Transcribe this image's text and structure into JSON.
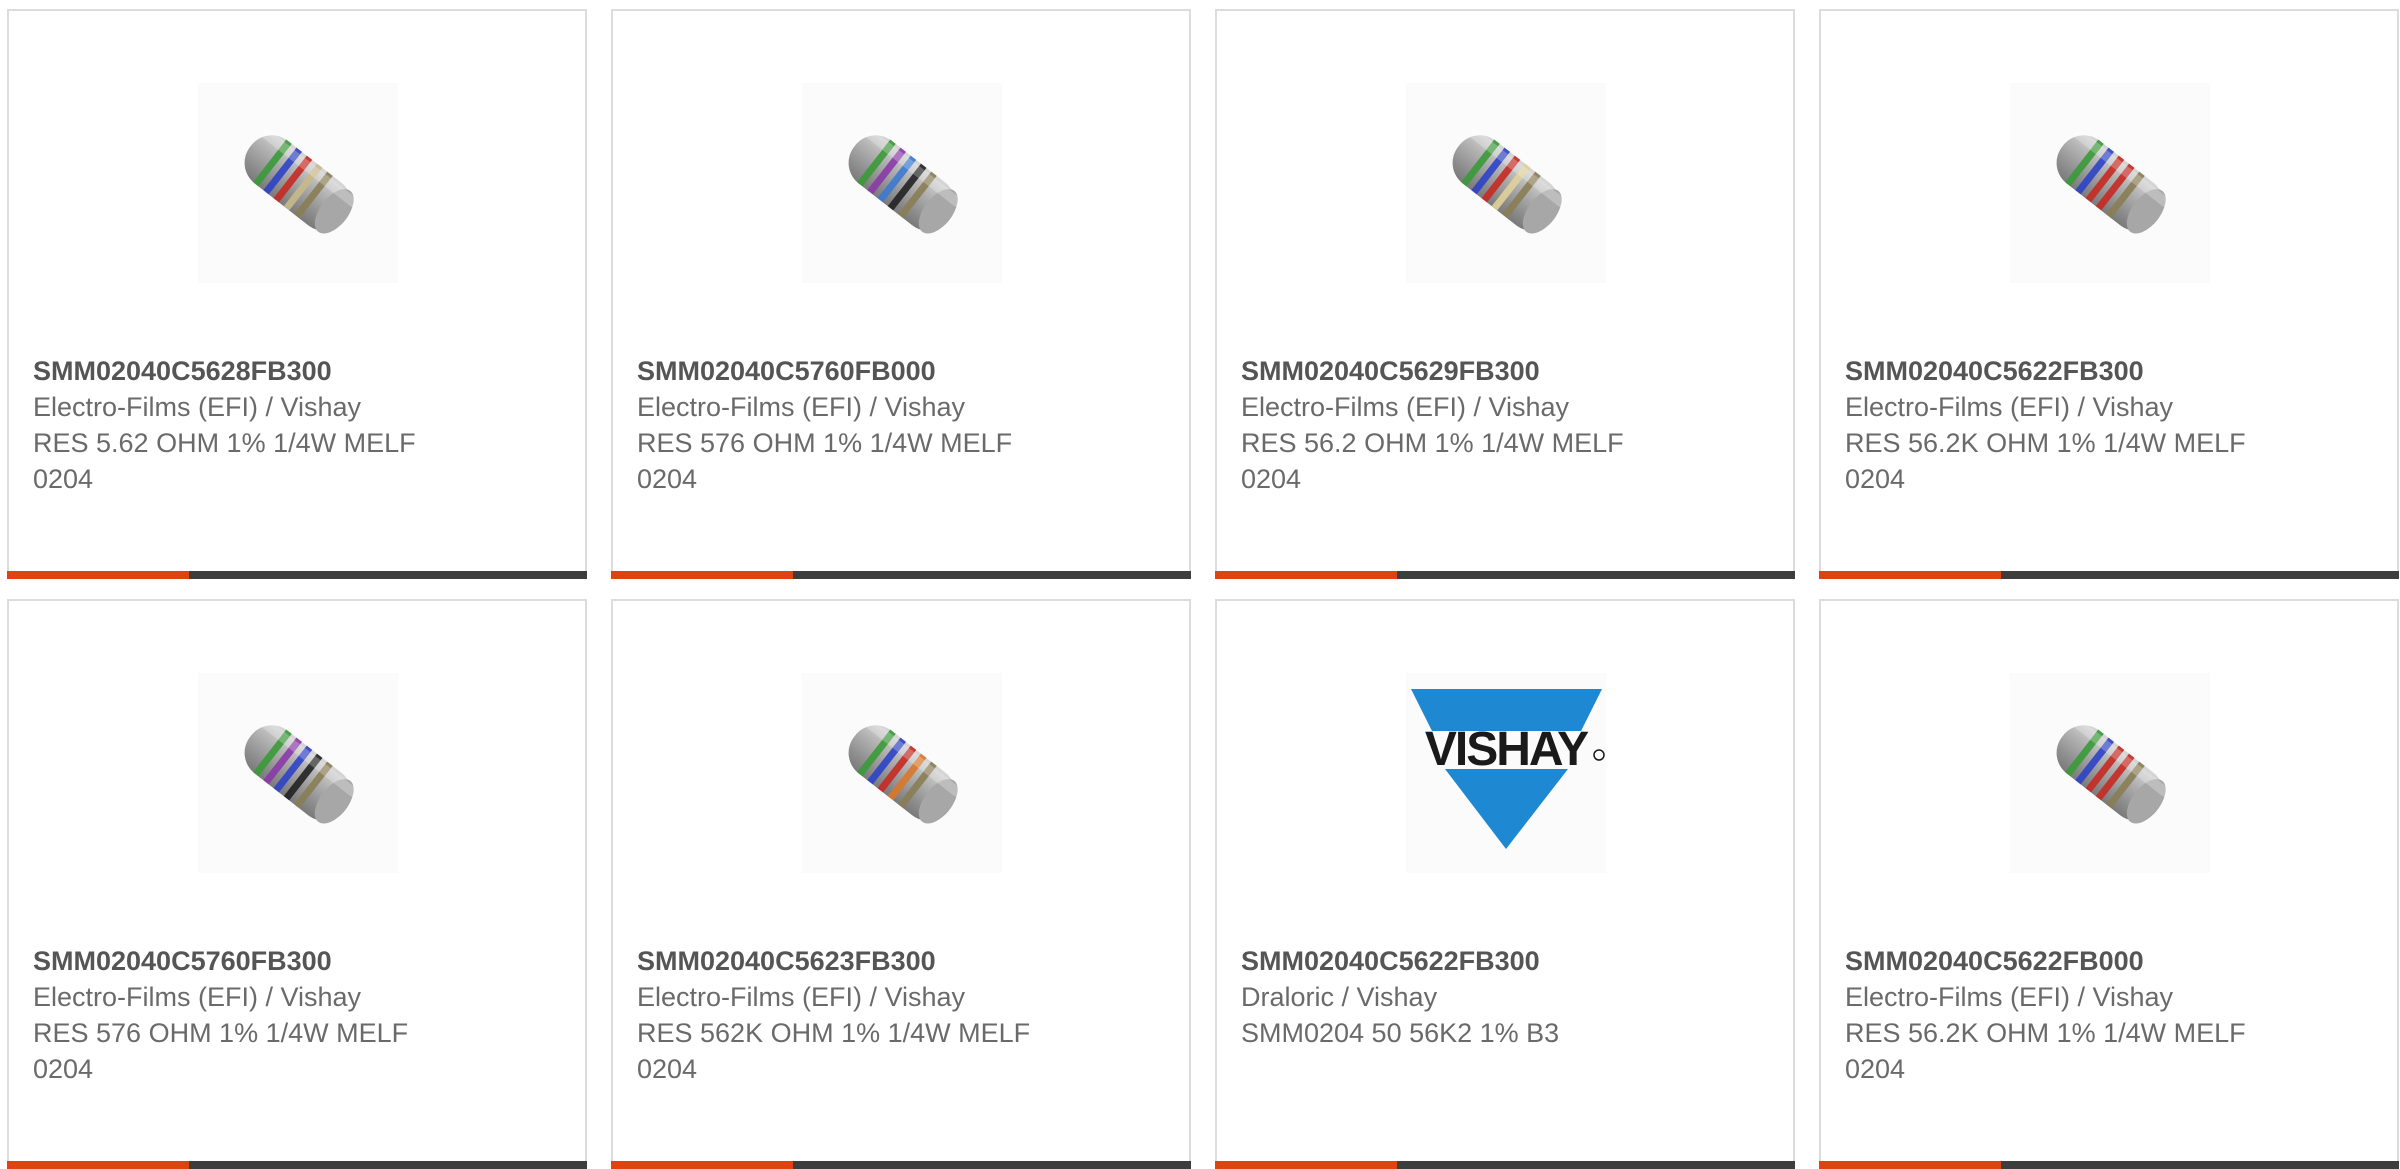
{
  "colors": {
    "accent": "#e04312",
    "bar": "#3d3d3d",
    "border": "#dcdcdc",
    "text": "#5e5e5e",
    "vishay_blue": "#1e88d2"
  },
  "products": [
    {
      "part_number": "SMM02040C5628FB300",
      "manufacturer": "Electro-Films (EFI) / Vishay",
      "description": "RES 5.62 OHM 1% 1/4W MELF 0204",
      "image": "resistor-image",
      "bands": [
        "#3a9a3a",
        "#2f43c6",
        "#c72a22",
        "#c9b98a",
        "#8a7d55"
      ]
    },
    {
      "part_number": "SMM02040C5760FB000",
      "manufacturer": "Electro-Films (EFI) / Vishay",
      "description": "RES 576 OHM 1% 1/4W MELF 0204",
      "image": "resistor-image",
      "bands": [
        "#3a9a3a",
        "#8a3aa8",
        "#3c7ad0",
        "#222222",
        "#8a7d55"
      ]
    },
    {
      "part_number": "SMM02040C5629FB300",
      "manufacturer": "Electro-Films (EFI) / Vishay",
      "description": "RES 56.2 OHM 1% 1/4W MELF 0204",
      "image": "resistor-image",
      "bands": [
        "#3a9a3a",
        "#2f43c6",
        "#c72a22",
        "#e0d29a",
        "#8a7d55"
      ]
    },
    {
      "part_number": "SMM02040C5622FB300",
      "manufacturer": "Electro-Films (EFI) / Vishay",
      "description": "RES 56.2K OHM 1% 1/4W MELF 0204",
      "image": "resistor-image",
      "bands": [
        "#3a9a3a",
        "#2f43c6",
        "#c72a22",
        "#c72a22",
        "#8a7d55"
      ]
    },
    {
      "part_number": "SMM02040C5760FB300",
      "manufacturer": "Electro-Films (EFI) / Vishay",
      "description": "RES 576 OHM 1% 1/4W MELF 0204",
      "image": "resistor-image",
      "bands": [
        "#3a9a3a",
        "#8a3aa8",
        "#2f43c6",
        "#222222",
        "#8a7d55"
      ]
    },
    {
      "part_number": "SMM02040C5623FB300",
      "manufacturer": "Electro-Films (EFI) / Vishay",
      "description": "RES 562K OHM 1% 1/4W MELF 0204",
      "image": "resistor-image",
      "bands": [
        "#3a9a3a",
        "#2f43c6",
        "#c72a22",
        "#d9782a",
        "#8a7d55"
      ]
    },
    {
      "part_number": "SMM02040C5622FB300",
      "manufacturer": "Draloric / Vishay",
      "description": "SMM0204 50 56K2 1% B3",
      "image": "vishay-logo",
      "logo_text": "VISHAY"
    },
    {
      "part_number": "SMM02040C5622FB000",
      "manufacturer": "Electro-Films (EFI) / Vishay",
      "description": "RES 56.2K OHM 1% 1/4W MELF 0204",
      "image": "resistor-image",
      "bands": [
        "#3a9a3a",
        "#2f43c6",
        "#c72a22",
        "#c72a22",
        "#8a7d55"
      ]
    }
  ]
}
